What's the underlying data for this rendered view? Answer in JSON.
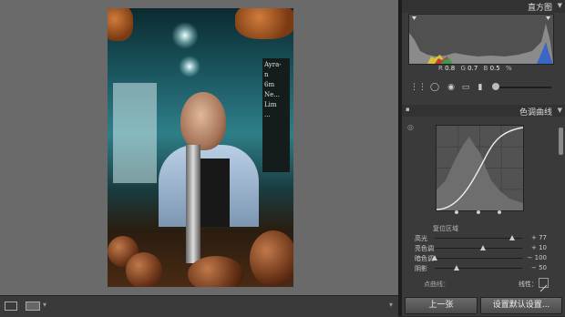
{
  "histogram": {
    "title": "直方图",
    "readout": {
      "r_label": "R",
      "r": "0.8",
      "g_label": "G",
      "g": "0.7",
      "b_label": "B",
      "b": "0.5",
      "unit": "%"
    }
  },
  "tone_curve": {
    "title": "色调曲线",
    "region_label": "复位区域",
    "sliders": [
      {
        "label": "高光",
        "value": "+ 77",
        "level": 0.89
      },
      {
        "label": "亮色调",
        "value": "+ 10",
        "level": 0.55
      },
      {
        "label": "暗色调",
        "value": "− 100",
        "level": 0.0
      },
      {
        "label": "阴影",
        "value": "− 50",
        "level": 0.25
      }
    ],
    "point_curve_label": "点曲线：",
    "linear_label": "线性："
  },
  "photo_board": [
    "Ayra-",
    "n",
    "6m",
    "Ne...",
    "Lim",
    "..."
  ],
  "buttons": {
    "previous": "上一张",
    "reset": "设置默认设置..."
  },
  "bottombar": {
    "view_icon": "loupe-view-icon",
    "compare_icon": "compare-view-icon"
  }
}
